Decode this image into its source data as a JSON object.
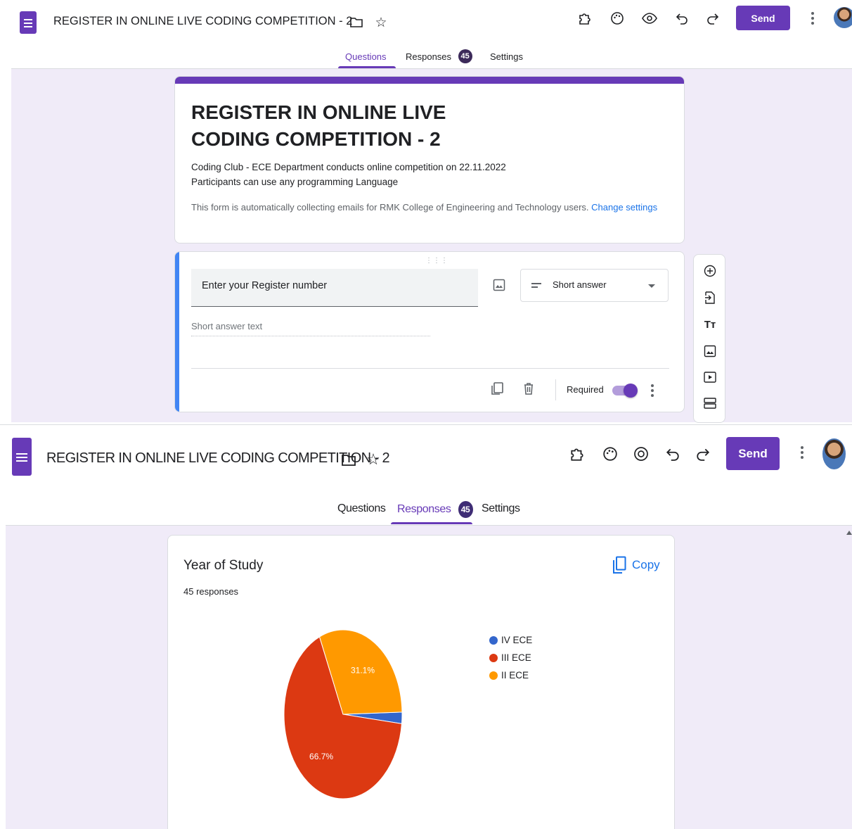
{
  "header": {
    "title": "REGISTER IN ONLINE LIVE CODING COMPETITION - 2",
    "send_label": "Send"
  },
  "tabs": [
    {
      "label": "Questions"
    },
    {
      "label": "Responses",
      "badge": "45"
    },
    {
      "label": "Settings"
    }
  ],
  "form": {
    "title": "REGISTER IN ONLINE LIVE CODING COMPETITION - 2",
    "description_line1": "Coding Club - ECE Department conducts online competition  on 22.11.2022",
    "description_line2": "Participants can use any programming Language",
    "email_note": "This form is automatically collecting emails for RMK College of Engineering and Technology users.",
    "change_settings_link": "Change settings"
  },
  "question": {
    "text": "Enter your Register number",
    "type": "Short answer",
    "answer_placeholder": "Short answer text",
    "required_label": "Required",
    "required": true
  },
  "summary": {
    "title": "Year of Study",
    "responses_text": "45 responses",
    "copy_label": "Copy"
  },
  "chart_data": {
    "type": "pie",
    "title": "Year of Study",
    "total_responses": 45,
    "slices": [
      {
        "label": "IV ECE",
        "value": 2.2,
        "color": "#3366cc"
      },
      {
        "label": "III ECE",
        "value": 66.7,
        "color": "#dc3912"
      },
      {
        "label": "II ECE",
        "value": 31.1,
        "color": "#ff9900"
      }
    ],
    "data_labels": [
      "66.7%",
      "31.1%"
    ],
    "legend_position": "right"
  }
}
